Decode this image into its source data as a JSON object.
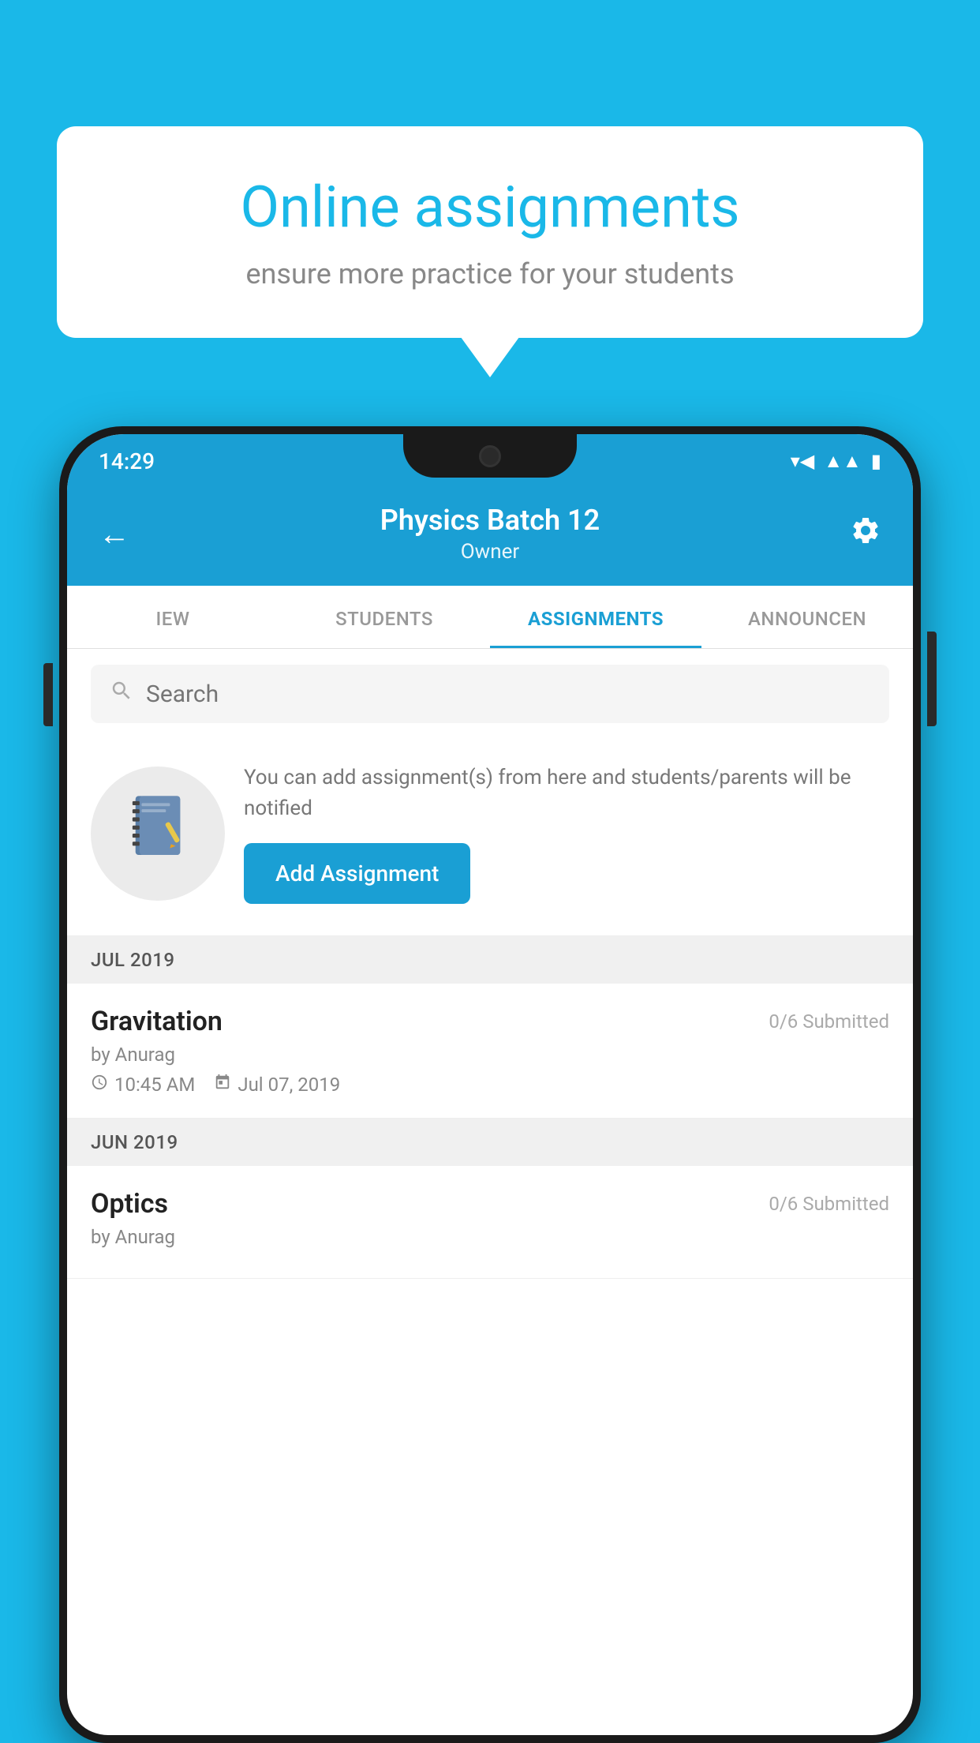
{
  "background_color": "#1ab8e8",
  "speech_bubble": {
    "title": "Online assignments",
    "subtitle": "ensure more practice for your students"
  },
  "status_bar": {
    "time": "14:29",
    "wifi_icon": "wifi",
    "signal_icon": "signal",
    "battery_icon": "battery"
  },
  "app_header": {
    "back_label": "←",
    "title": "Physics Batch 12",
    "subtitle": "Owner",
    "settings_icon": "gear"
  },
  "tabs": [
    {
      "label": "IEW",
      "active": false
    },
    {
      "label": "STUDENTS",
      "active": false
    },
    {
      "label": "ASSIGNMENTS",
      "active": true
    },
    {
      "label": "ANNOUNCEN",
      "active": false
    }
  ],
  "search": {
    "placeholder": "Search"
  },
  "promo": {
    "description": "You can add assignment(s) from here and students/parents will be notified",
    "button_label": "Add Assignment"
  },
  "months": [
    {
      "label": "JUL 2019",
      "assignments": [
        {
          "title": "Gravitation",
          "submitted": "0/6 Submitted",
          "by": "by Anurag",
          "time": "10:45 AM",
          "date": "Jul 07, 2019"
        }
      ]
    },
    {
      "label": "JUN 2019",
      "assignments": [
        {
          "title": "Optics",
          "submitted": "0/6 Submitted",
          "by": "by Anurag",
          "time": "",
          "date": ""
        }
      ]
    }
  ]
}
